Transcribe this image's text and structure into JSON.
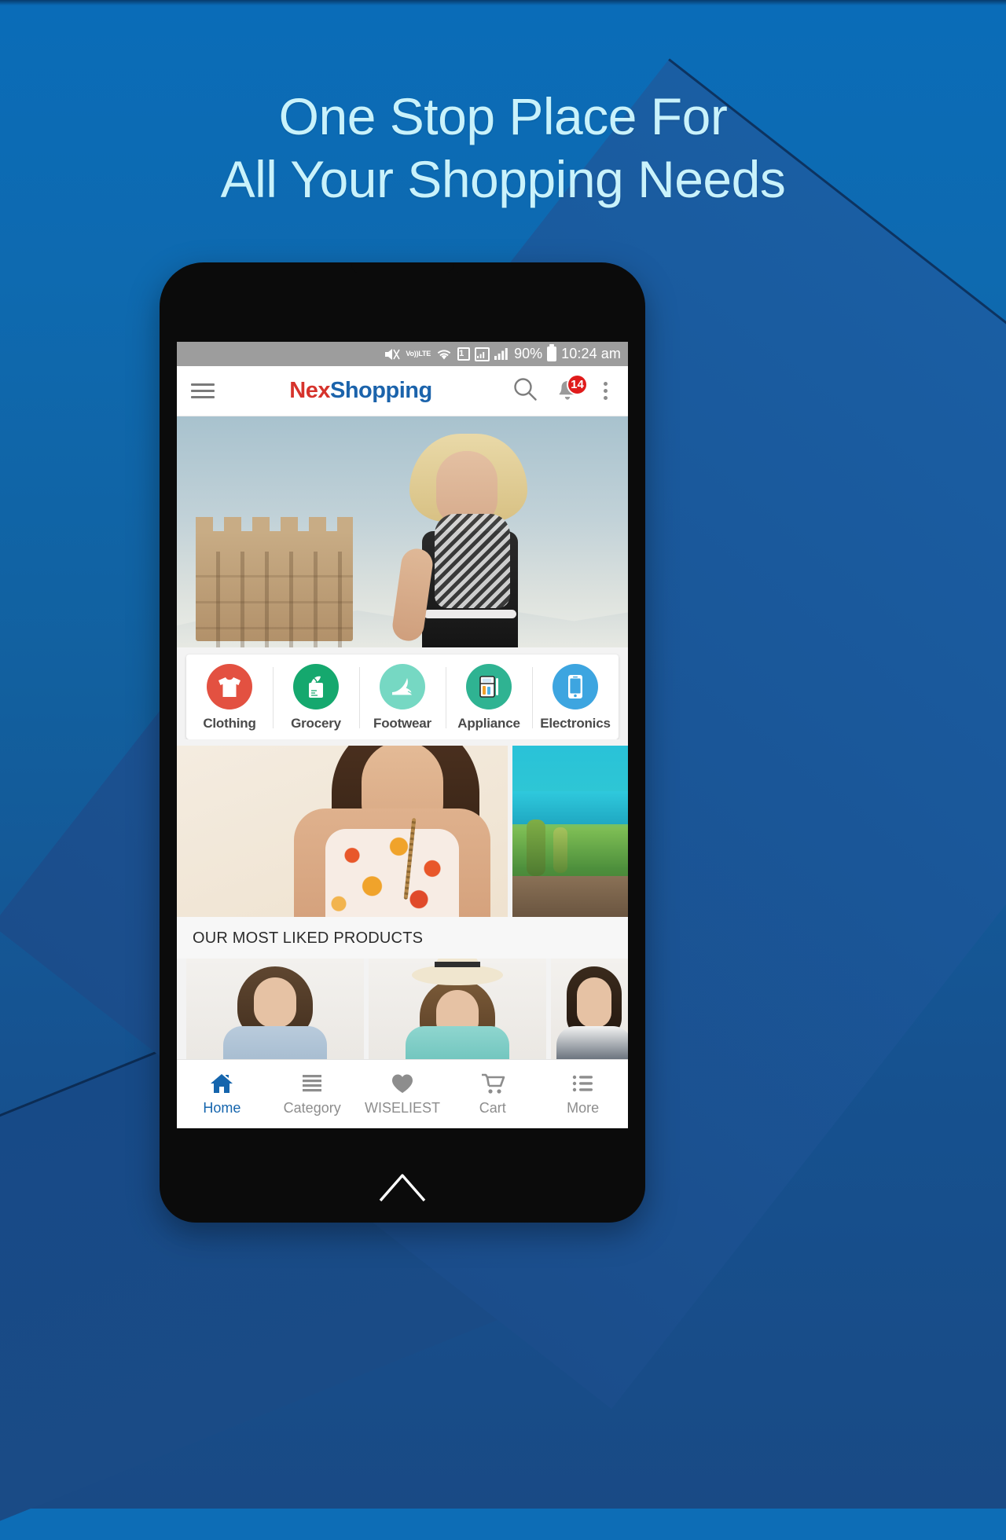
{
  "promo": {
    "headline_line1": "One Stop Place For",
    "headline_line2": "All Your Shopping Needs",
    "headline_color": "#c9f2fb",
    "background_top": "#0a6cb8",
    "background_bottom": "#194a85"
  },
  "status_bar": {
    "mute_icon": "speaker-mute-icon",
    "volte_top": "Vo))",
    "volte_bottom": "LTE",
    "wifi_icon": "wifi-icon",
    "sim_label": "1",
    "signal_icon_1": "signal-bars-boxed-icon",
    "signal_icon_2": "signal-bars-icon",
    "battery_percent": "90%",
    "battery_icon": "battery-icon",
    "time": "10:24 am"
  },
  "app_bar": {
    "menu_icon": "hamburger-menu-icon",
    "brand_part1": "Nex",
    "brand_part2": "Shopping",
    "brand_color_1": "#d6332c",
    "brand_color_2": "#1b63ab",
    "search_icon": "search-icon",
    "notifications_icon": "bell-icon",
    "notifications_count": "14",
    "notifications_badge_color": "#e01b1b",
    "overflow_icon": "kebab-menu-icon"
  },
  "hero_banner": {
    "name": "hero-fashion-banner",
    "alt": "Woman in black dress with scarf beside stone castle"
  },
  "categories": [
    {
      "label": "Clothing",
      "icon": "tshirt-icon",
      "color": "#e35141"
    },
    {
      "label": "Grocery",
      "icon": "grocery-bag-icon",
      "color": "#15a86e"
    },
    {
      "label": "Footwear",
      "icon": "high-heel-icon",
      "color": "#76d8c3"
    },
    {
      "label": "Appliance",
      "icon": "refrigerator-icon",
      "color": "#2fb392"
    },
    {
      "label": "Electronics",
      "icon": "smartphone-icon",
      "color": "#3da5e0"
    }
  ],
  "promo_tiles": [
    {
      "name": "promo-tile-fashion-large",
      "alt": "Woman in floral print top with long chain necklace"
    },
    {
      "name": "promo-tile-outdoor-small",
      "alt": "Lakeside deck with trees and turquoise water"
    }
  ],
  "section": {
    "title": "OUR MOST LIKED PRODUCTS"
  },
  "products": [
    {
      "name": "product-card-1",
      "alt": "Woman in light blue denim shirt"
    },
    {
      "name": "product-card-2",
      "alt": "Woman in mint shirt wearing straw hat"
    },
    {
      "name": "product-card-3",
      "alt": "Woman in navy and white top"
    }
  ],
  "bottom_nav": {
    "active": "Home",
    "active_color": "#1565ad",
    "inactive_color": "#8d8d8d",
    "items": [
      {
        "label": "Home",
        "icon": "home-icon",
        "active": true
      },
      {
        "label": "Category",
        "icon": "list-icon",
        "active": false
      },
      {
        "label": "WISELIEST",
        "icon": "heart-icon",
        "active": false
      },
      {
        "label": "Cart",
        "icon": "cart-icon",
        "active": false
      },
      {
        "label": "More",
        "icon": "more-list-icon",
        "active": false
      }
    ]
  },
  "device": {
    "home_button_icon": "home-capacitive-button"
  }
}
